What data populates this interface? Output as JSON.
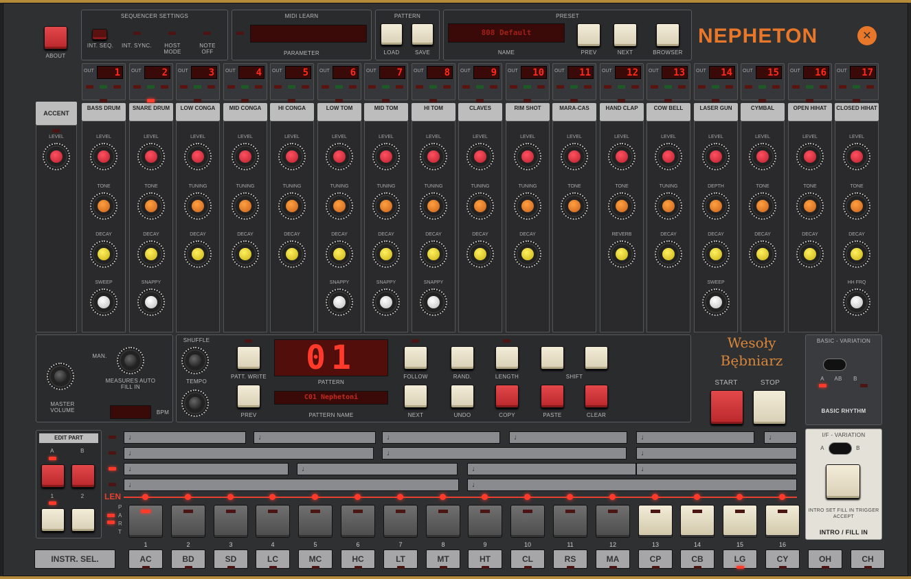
{
  "about": {
    "label": "ABOUT"
  },
  "seq_settings": {
    "title": "SEQUENCER SETTINGS",
    "items": [
      "INT. SEQ.",
      "INT. SYNC.",
      "HOST MODE",
      "NOTE OFF"
    ]
  },
  "midi_learn": {
    "title": "MIDI LEARN",
    "param_label": "PARAMETER"
  },
  "pattern": {
    "title": "PATTERN",
    "load": "LOAD",
    "save": "SAVE"
  },
  "preset": {
    "title": "PRESET",
    "name_label": "NAME",
    "name_value": "808 Default",
    "prev": "PREV",
    "next": "NEXT",
    "browser": "BROWSER"
  },
  "brand": {
    "logo": "NEPHETON"
  },
  "accent": {
    "name": "ACCENT",
    "level": "LEVEL"
  },
  "channels": [
    {
      "out": "OUT",
      "num": "1",
      "name": "BASS DRUM",
      "k1": "LEVEL",
      "k2": "TONE",
      "k3": "DECAY",
      "k4": "SWEEP"
    },
    {
      "out": "OUT",
      "num": "2",
      "name": "SNARE DRUM",
      "k1": "LEVEL",
      "k2": "TONE",
      "k3": "DECAY",
      "k4": "SNAPPY"
    },
    {
      "out": "OUT",
      "num": "3",
      "name": "LOW CONGA",
      "k1": "LEVEL",
      "k2": "TUNING",
      "k3": "DECAY",
      "k4": ""
    },
    {
      "out": "OUT",
      "num": "4",
      "name": "MID CONGA",
      "k1": "LEVEL",
      "k2": "TUNING",
      "k3": "DECAY",
      "k4": ""
    },
    {
      "out": "OUT",
      "num": "5",
      "name": "HI CONGA",
      "k1": "LEVEL",
      "k2": "TUNING",
      "k3": "DECAY",
      "k4": ""
    },
    {
      "out": "OUT",
      "num": "6",
      "name": "LOW TOM",
      "k1": "LEVEL",
      "k2": "TUNING",
      "k3": "DECAY",
      "k4": "SNAPPY"
    },
    {
      "out": "OUT",
      "num": "7",
      "name": "MID TOM",
      "k1": "LEVEL",
      "k2": "TUNING",
      "k3": "DECAY",
      "k4": "SNAPPY"
    },
    {
      "out": "OUT",
      "num": "8",
      "name": "HI TOM",
      "k1": "LEVEL",
      "k2": "TUNING",
      "k3": "DECAY",
      "k4": "SNAPPY"
    },
    {
      "out": "OUT",
      "num": "9",
      "name": "CLAVES",
      "k1": "LEVEL",
      "k2": "TUNING",
      "k3": "DECAY",
      "k4": ""
    },
    {
      "out": "OUT",
      "num": "10",
      "name": "RIM SHOT",
      "k1": "LEVEL",
      "k2": "TUNING",
      "k3": "DECAY",
      "k4": ""
    },
    {
      "out": "OUT",
      "num": "11",
      "name": "MARA-CAS",
      "k1": "LEVEL",
      "k2": "TONE",
      "k3": "",
      "k4": ""
    },
    {
      "out": "OUT",
      "num": "12",
      "name": "HAND CLAP",
      "k1": "LEVEL",
      "k2": "TONE",
      "k3": "REVERB",
      "k4": ""
    },
    {
      "out": "OUT",
      "num": "13",
      "name": "COW BELL",
      "k1": "LEVEL",
      "k2": "TUNING",
      "k3": "DECAY",
      "k4": ""
    },
    {
      "out": "OUT",
      "num": "14",
      "name": "LASER GUN",
      "k1": "LEVEL",
      "k2": "DEPTH",
      "k3": "DECAY",
      "k4": "SWEEP"
    },
    {
      "out": "OUT",
      "num": "15",
      "name": "CYMBAL",
      "k1": "LEVEL",
      "k2": "TONE",
      "k3": "DECAY",
      "k4": ""
    },
    {
      "out": "OUT",
      "num": "16",
      "name": "OPEN HIHAT",
      "k1": "LEVEL",
      "k2": "TONE",
      "k3": "DECAY",
      "k4": ""
    },
    {
      "out": "OUT",
      "num": "17",
      "name": "CLOSED HIHAT",
      "k1": "LEVEL",
      "k2": "TONE",
      "k3": "DECAY",
      "k4": "HH FRQ"
    }
  ],
  "transport": {
    "master_volume": "MASTER VOLUME",
    "measures": "MEASURES AUTO FILL IN",
    "man": "MAN.",
    "shuffle": "SHUFFLE",
    "tempo": "TEMPO",
    "bpm": "BPM",
    "patt_write": "PATT. WRITE",
    "prev": "PREV",
    "pattern_label": "PATTERN",
    "pattern_value": "01",
    "pattern_name_label": "PATTERN NAME",
    "pattern_name_value": "C01 Nephetoni",
    "follow": "FOLLOW",
    "rand": "RAND.",
    "length": "LENGTH",
    "shift": "SHIFT",
    "next": "NEXT",
    "undo": "UNDO",
    "copy": "COPY",
    "paste": "PASTE",
    "clear": "CLEAR",
    "start": "START",
    "stop": "STOP",
    "brand_script": "Wesoły Bębniarz"
  },
  "basic_variation": {
    "title": "BASIC - VARIATION",
    "a": "A",
    "ab": "AB",
    "b": "B",
    "footer": "BASIC RHYTHM"
  },
  "intro_fill": {
    "title": "I/F - VARIATION",
    "a": "A",
    "b": "B",
    "text": "INTRO SET FILL IN TRIGGER ACCEPT",
    "footer": "INTRO / FILL IN"
  },
  "edit_part": {
    "title": "EDIT PART",
    "a": "A",
    "b": "B",
    "one": "1",
    "two": "2"
  },
  "len": {
    "label": "LEN"
  },
  "part_letters": [
    "P",
    "A",
    "R",
    "T"
  ],
  "steps": [
    "1",
    "2",
    "3",
    "4",
    "5",
    "6",
    "7",
    "8",
    "9",
    "10",
    "11",
    "12",
    "13",
    "14",
    "15",
    "16"
  ],
  "lit_steps": [
    13,
    14,
    15,
    16
  ],
  "instr_sel": "INSTR. SEL.",
  "instruments": [
    "AC",
    "BD",
    "SD",
    "LC",
    "MC",
    "HC",
    "LT",
    "MT",
    "HT",
    "CL",
    "RS",
    "MA",
    "CP",
    "CB",
    "LG",
    "CY",
    "OH",
    "CH"
  ]
}
